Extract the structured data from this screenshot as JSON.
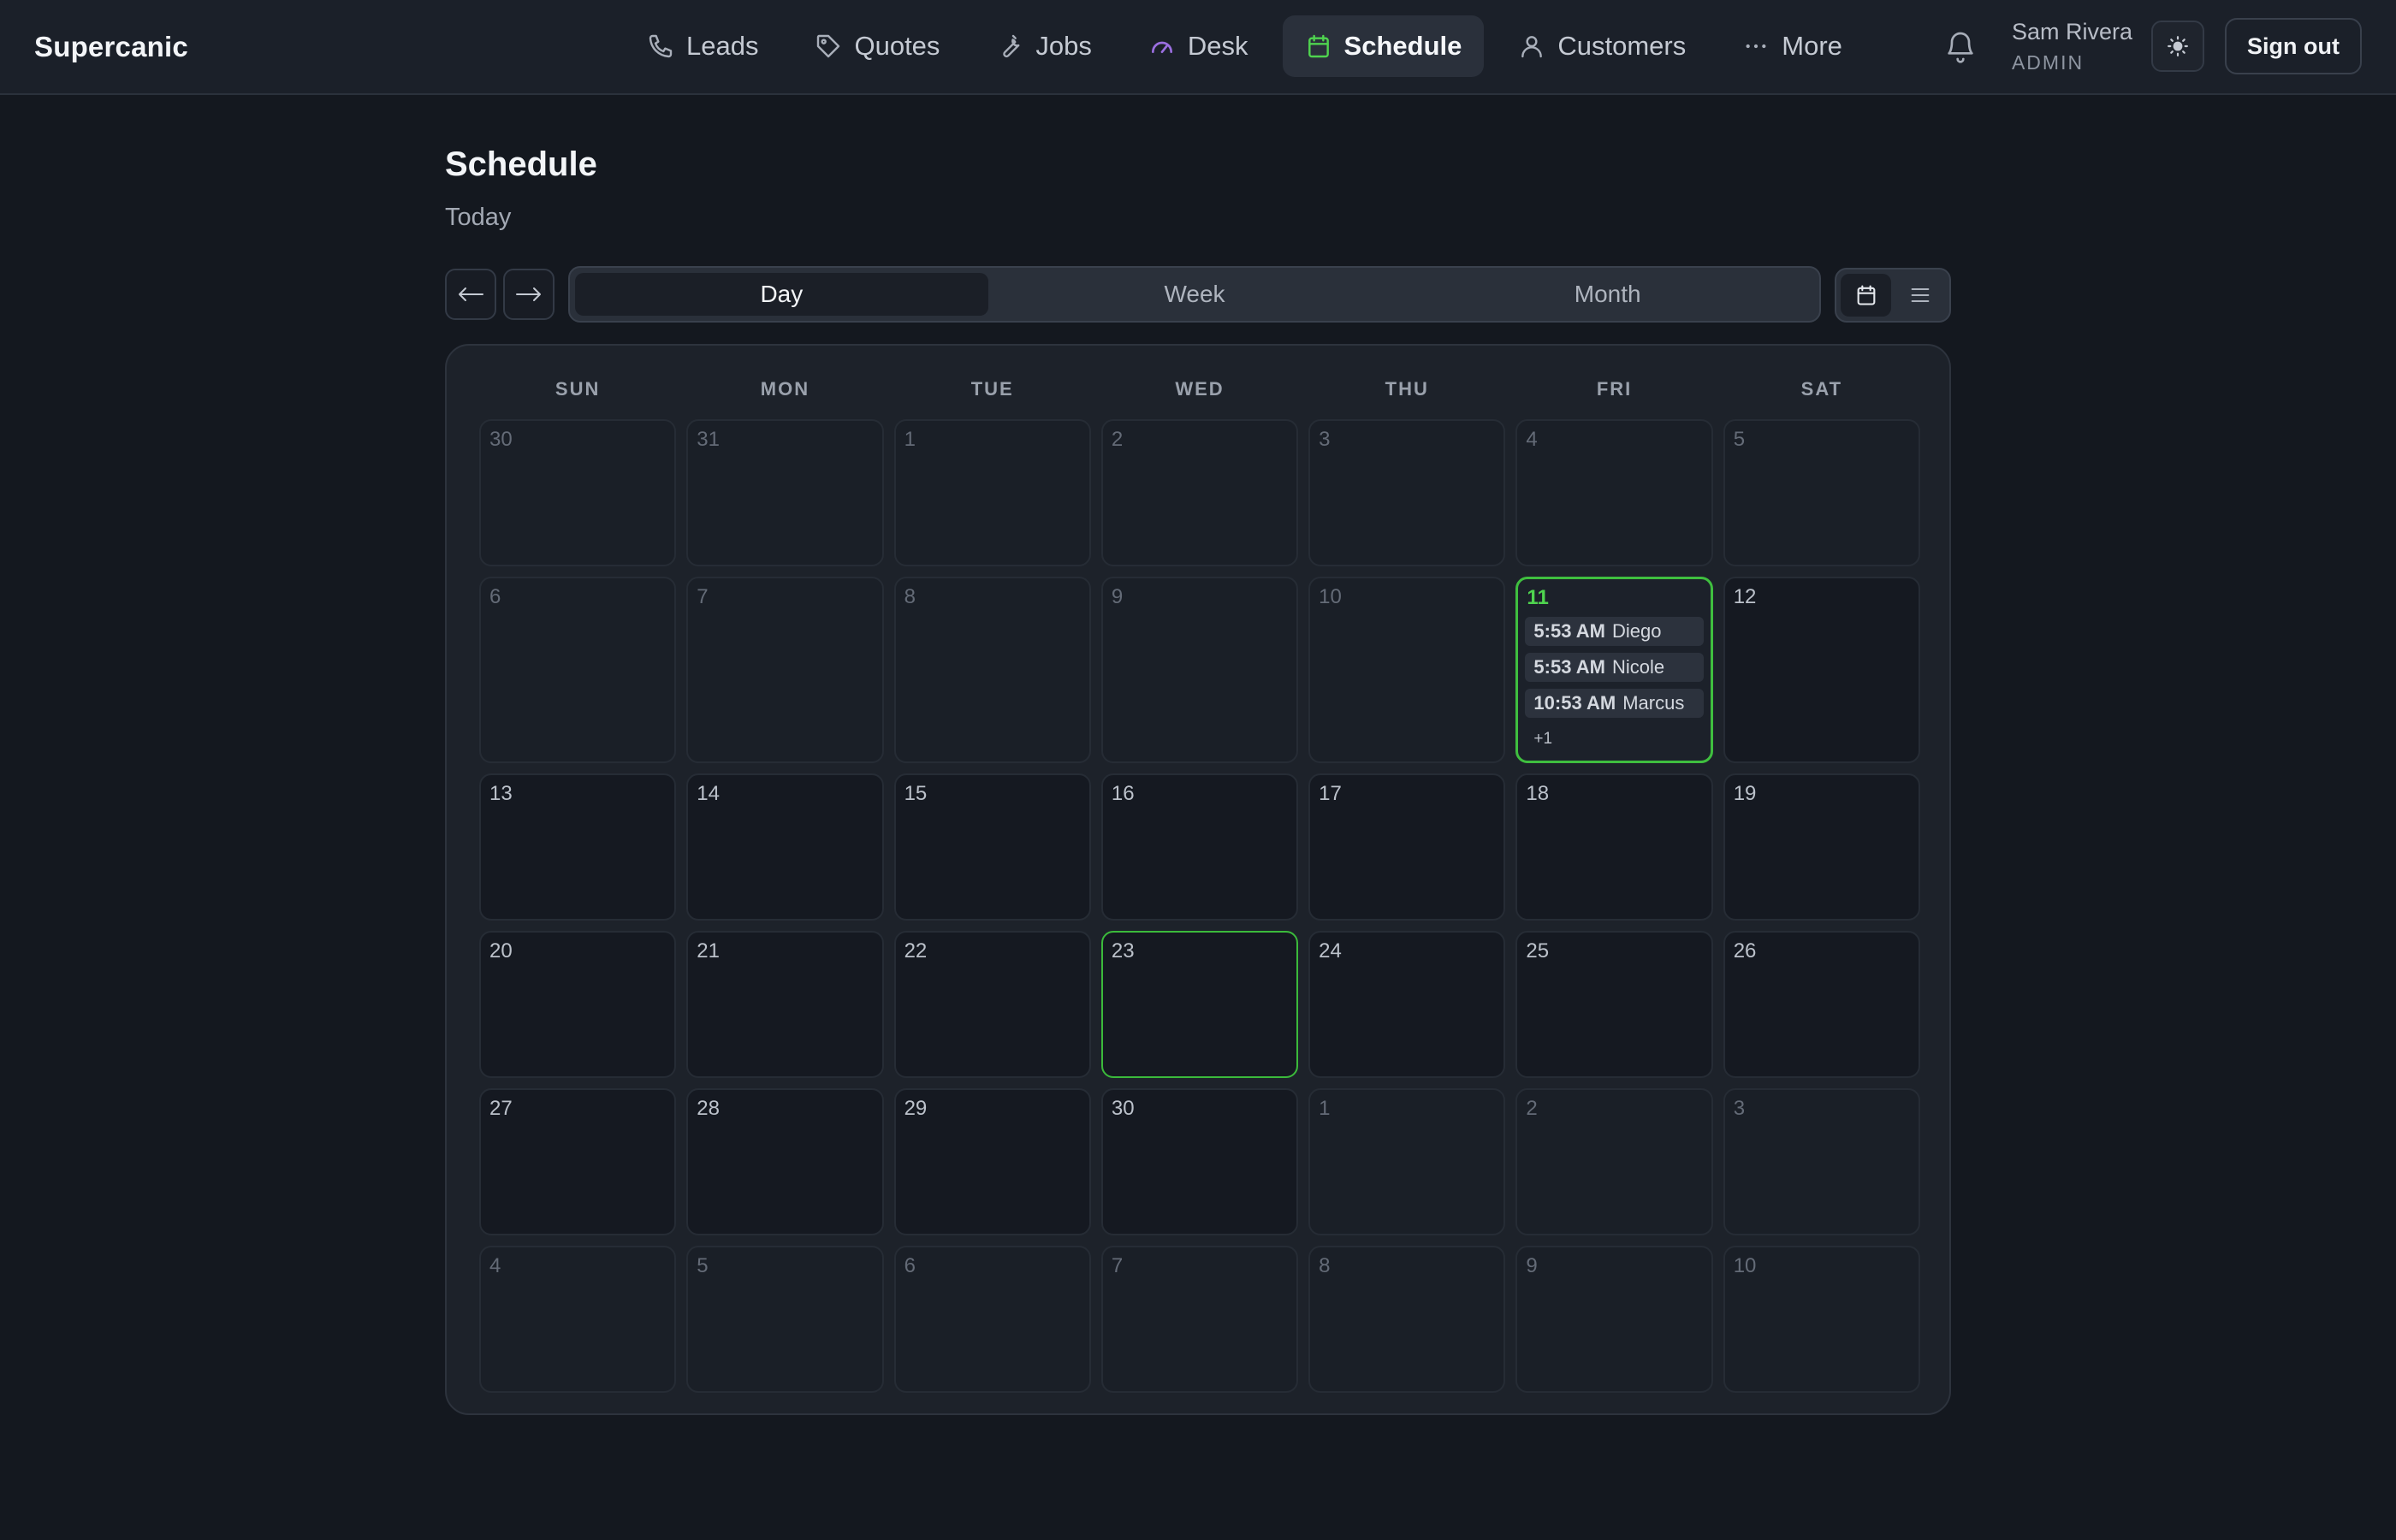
{
  "app": {
    "brand": "Supercanic"
  },
  "nav": {
    "items": [
      {
        "label": "Leads",
        "icon": "phone-icon"
      },
      {
        "label": "Quotes",
        "icon": "tag-icon"
      },
      {
        "label": "Jobs",
        "icon": "wrench-icon"
      },
      {
        "label": "Desk",
        "icon": "gauge-icon"
      },
      {
        "label": "Schedule",
        "icon": "calendar-icon",
        "active": true
      },
      {
        "label": "Customers",
        "icon": "user-icon"
      },
      {
        "label": "More",
        "icon": "dots-icon"
      }
    ],
    "accent": "#4fd44f"
  },
  "user": {
    "name": "Sam Rivera",
    "role": "ADMIN",
    "sign_out": "Sign out"
  },
  "header": {
    "title": "Schedule",
    "subtitle": "Today"
  },
  "controls": {
    "prev": "←",
    "next": "→",
    "views": [
      "Day",
      "Week",
      "Month"
    ],
    "active_view": "Day"
  },
  "calendar": {
    "weekdays": [
      "SUN",
      "MON",
      "TUE",
      "WED",
      "THU",
      "FRI",
      "SAT"
    ],
    "weeks": [
      [
        {
          "n": "30",
          "other": true
        },
        {
          "n": "31",
          "other": true
        },
        {
          "n": "1",
          "other": true
        },
        {
          "n": "2",
          "other": true
        },
        {
          "n": "3",
          "other": true
        },
        {
          "n": "4",
          "other": true
        },
        {
          "n": "5",
          "other": true
        }
      ],
      [
        {
          "n": "6",
          "other": true
        },
        {
          "n": "7",
          "other": true
        },
        {
          "n": "8",
          "other": true
        },
        {
          "n": "9",
          "other": true
        },
        {
          "n": "10",
          "other": true
        },
        {
          "n": "11",
          "selected": true,
          "events": [
            {
              "time": "5:53 AM",
              "name": "Diego"
            },
            {
              "time": "5:53 AM",
              "name": "Nicole"
            },
            {
              "time": "10:53 AM",
              "name": "Marcus"
            }
          ],
          "more": "+1"
        },
        {
          "n": "12"
        }
      ],
      [
        {
          "n": "13"
        },
        {
          "n": "14"
        },
        {
          "n": "15"
        },
        {
          "n": "16"
        },
        {
          "n": "17"
        },
        {
          "n": "18"
        },
        {
          "n": "19"
        }
      ],
      [
        {
          "n": "20"
        },
        {
          "n": "21"
        },
        {
          "n": "22"
        },
        {
          "n": "23",
          "today": true
        },
        {
          "n": "24"
        },
        {
          "n": "25"
        },
        {
          "n": "26"
        }
      ],
      [
        {
          "n": "27"
        },
        {
          "n": "28"
        },
        {
          "n": "29"
        },
        {
          "n": "30"
        },
        {
          "n": "1",
          "other": true
        },
        {
          "n": "2",
          "other": true
        },
        {
          "n": "3",
          "other": true
        }
      ],
      [
        {
          "n": "4",
          "other": true
        },
        {
          "n": "5",
          "other": true
        },
        {
          "n": "6",
          "other": true
        },
        {
          "n": "7",
          "other": true
        },
        {
          "n": "8",
          "other": true
        },
        {
          "n": "9",
          "other": true
        },
        {
          "n": "10",
          "other": true
        }
      ]
    ]
  }
}
